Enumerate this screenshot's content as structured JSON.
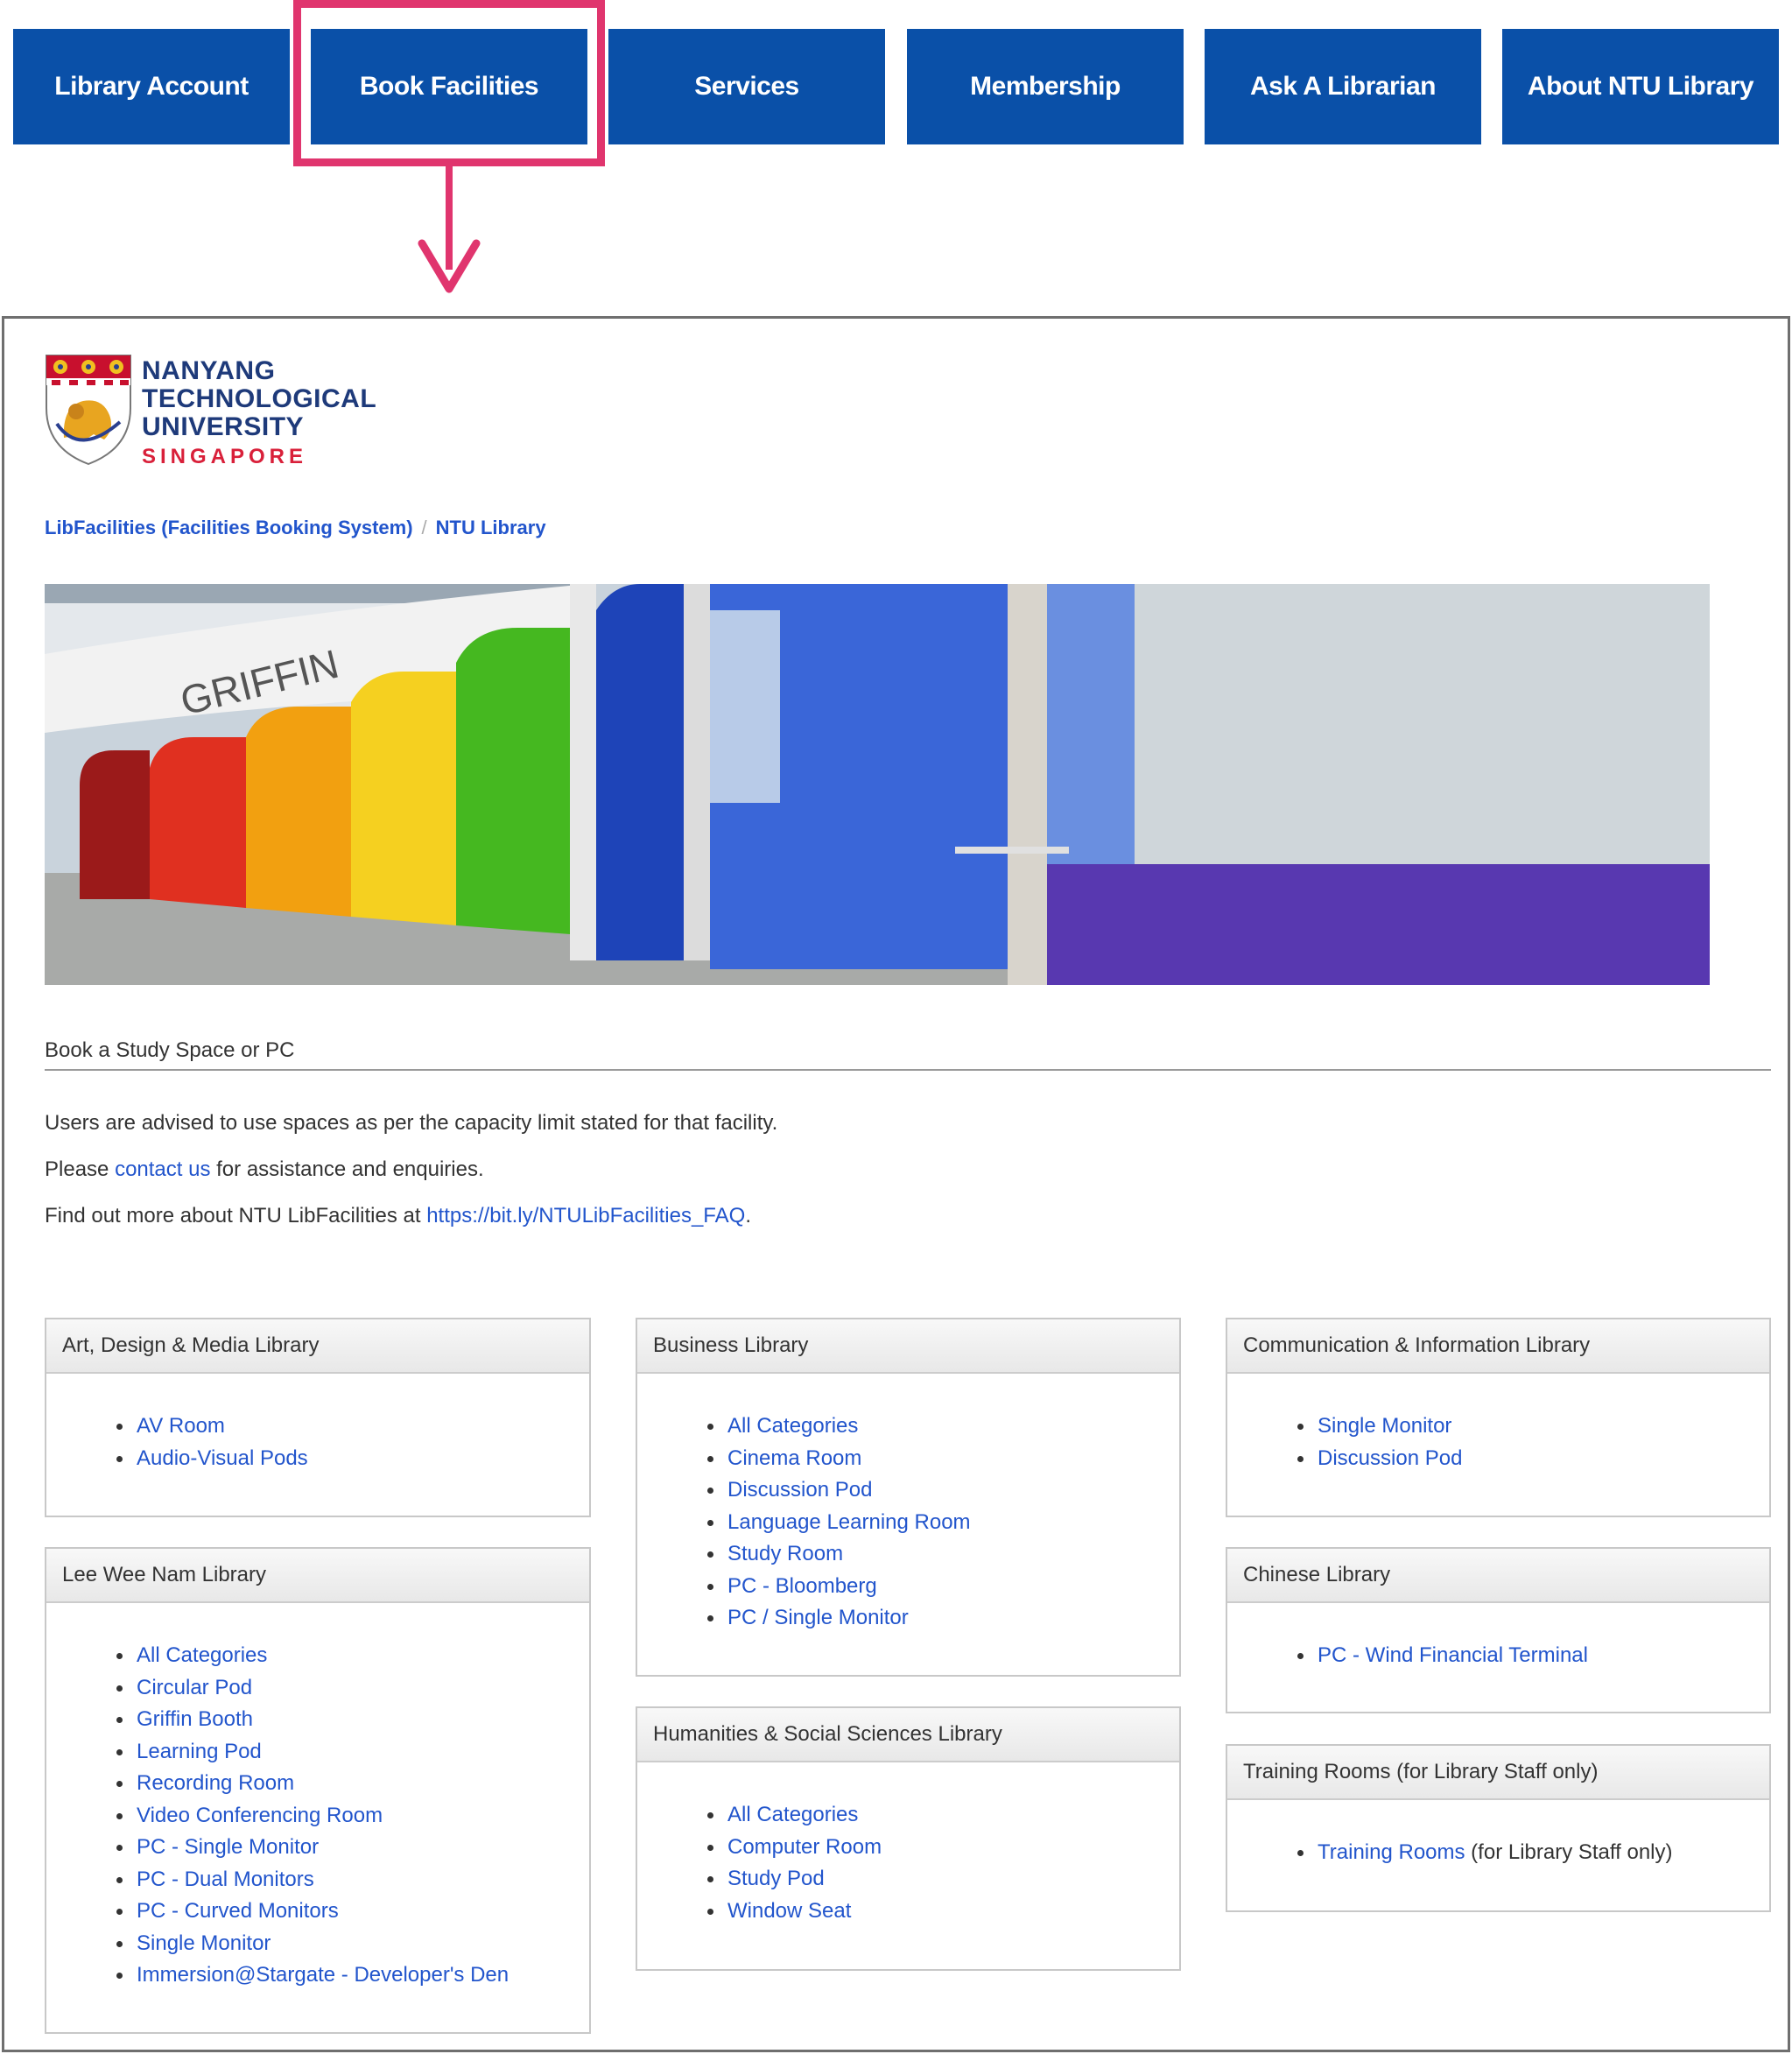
{
  "nav": {
    "items": [
      {
        "label": "Library Account"
      },
      {
        "label": "Book Facilities"
      },
      {
        "label": "Services"
      },
      {
        "label": "Membership"
      },
      {
        "label": "Ask A Librarian"
      },
      {
        "label": "About NTU Library"
      }
    ],
    "highlighted": "Book Facilities"
  },
  "colors": {
    "nav_bg": "#0a50a8",
    "highlight": "#e0356e",
    "link": "#2255cc"
  },
  "logo": {
    "line1": "NANYANG",
    "line2": "TECHNOLOGICAL",
    "line3": "UNIVERSITY",
    "line4": "SINGAPORE"
  },
  "breadcrumb": {
    "item1": "LibFacilities (Facilities Booking System)",
    "separator": "/",
    "item2": "NTU Library"
  },
  "banner": {
    "sign": "GRIFFIN"
  },
  "section_title": "Book a Study Space or PC",
  "intro": {
    "line1": "Users are advised to use spaces as per the capacity limit stated for that facility.",
    "line2_pre": "Please ",
    "line2_link": "contact us",
    "line2_post": " for assistance and enquiries.",
    "line3_pre": "Find out more about NTU LibFacilities at ",
    "line3_link": "https://bit.ly/NTULibFacilities_FAQ",
    "line3_post": "."
  },
  "panels": {
    "adm": {
      "title": "Art, Design & Media Library",
      "items": [
        "AV Room",
        "Audio-Visual Pods"
      ]
    },
    "lwn": {
      "title": "Lee Wee Nam Library",
      "items": [
        "All Categories",
        "Circular Pod",
        "Griffin Booth",
        "Learning Pod",
        "Recording Room",
        "Video Conferencing Room",
        "PC - Single Monitor",
        "PC - Dual Monitors",
        "PC - Curved Monitors",
        "Single Monitor",
        "Immersion@Stargate - Developer's Den"
      ]
    },
    "biz": {
      "title": "Business Library",
      "items": [
        "All Categories",
        "Cinema Room",
        "Discussion Pod",
        "Language Learning Room",
        "Study Room",
        "PC - Bloomberg",
        "PC / Single Monitor"
      ]
    },
    "hss": {
      "title": "Humanities & Social Sciences Library",
      "items": [
        "All Categories",
        "Computer Room",
        "Study Pod",
        "Window Seat"
      ]
    },
    "ci": {
      "title": "Communication & Information Library",
      "items": [
        "Single Monitor",
        "Discussion Pod"
      ]
    },
    "chn": {
      "title": "Chinese Library",
      "items": [
        "PC - Wind Financial Terminal"
      ]
    },
    "train": {
      "title": "Training Rooms (for Library Staff only)",
      "link": "Training Rooms",
      "suffix": " (for Library Staff only)"
    }
  }
}
